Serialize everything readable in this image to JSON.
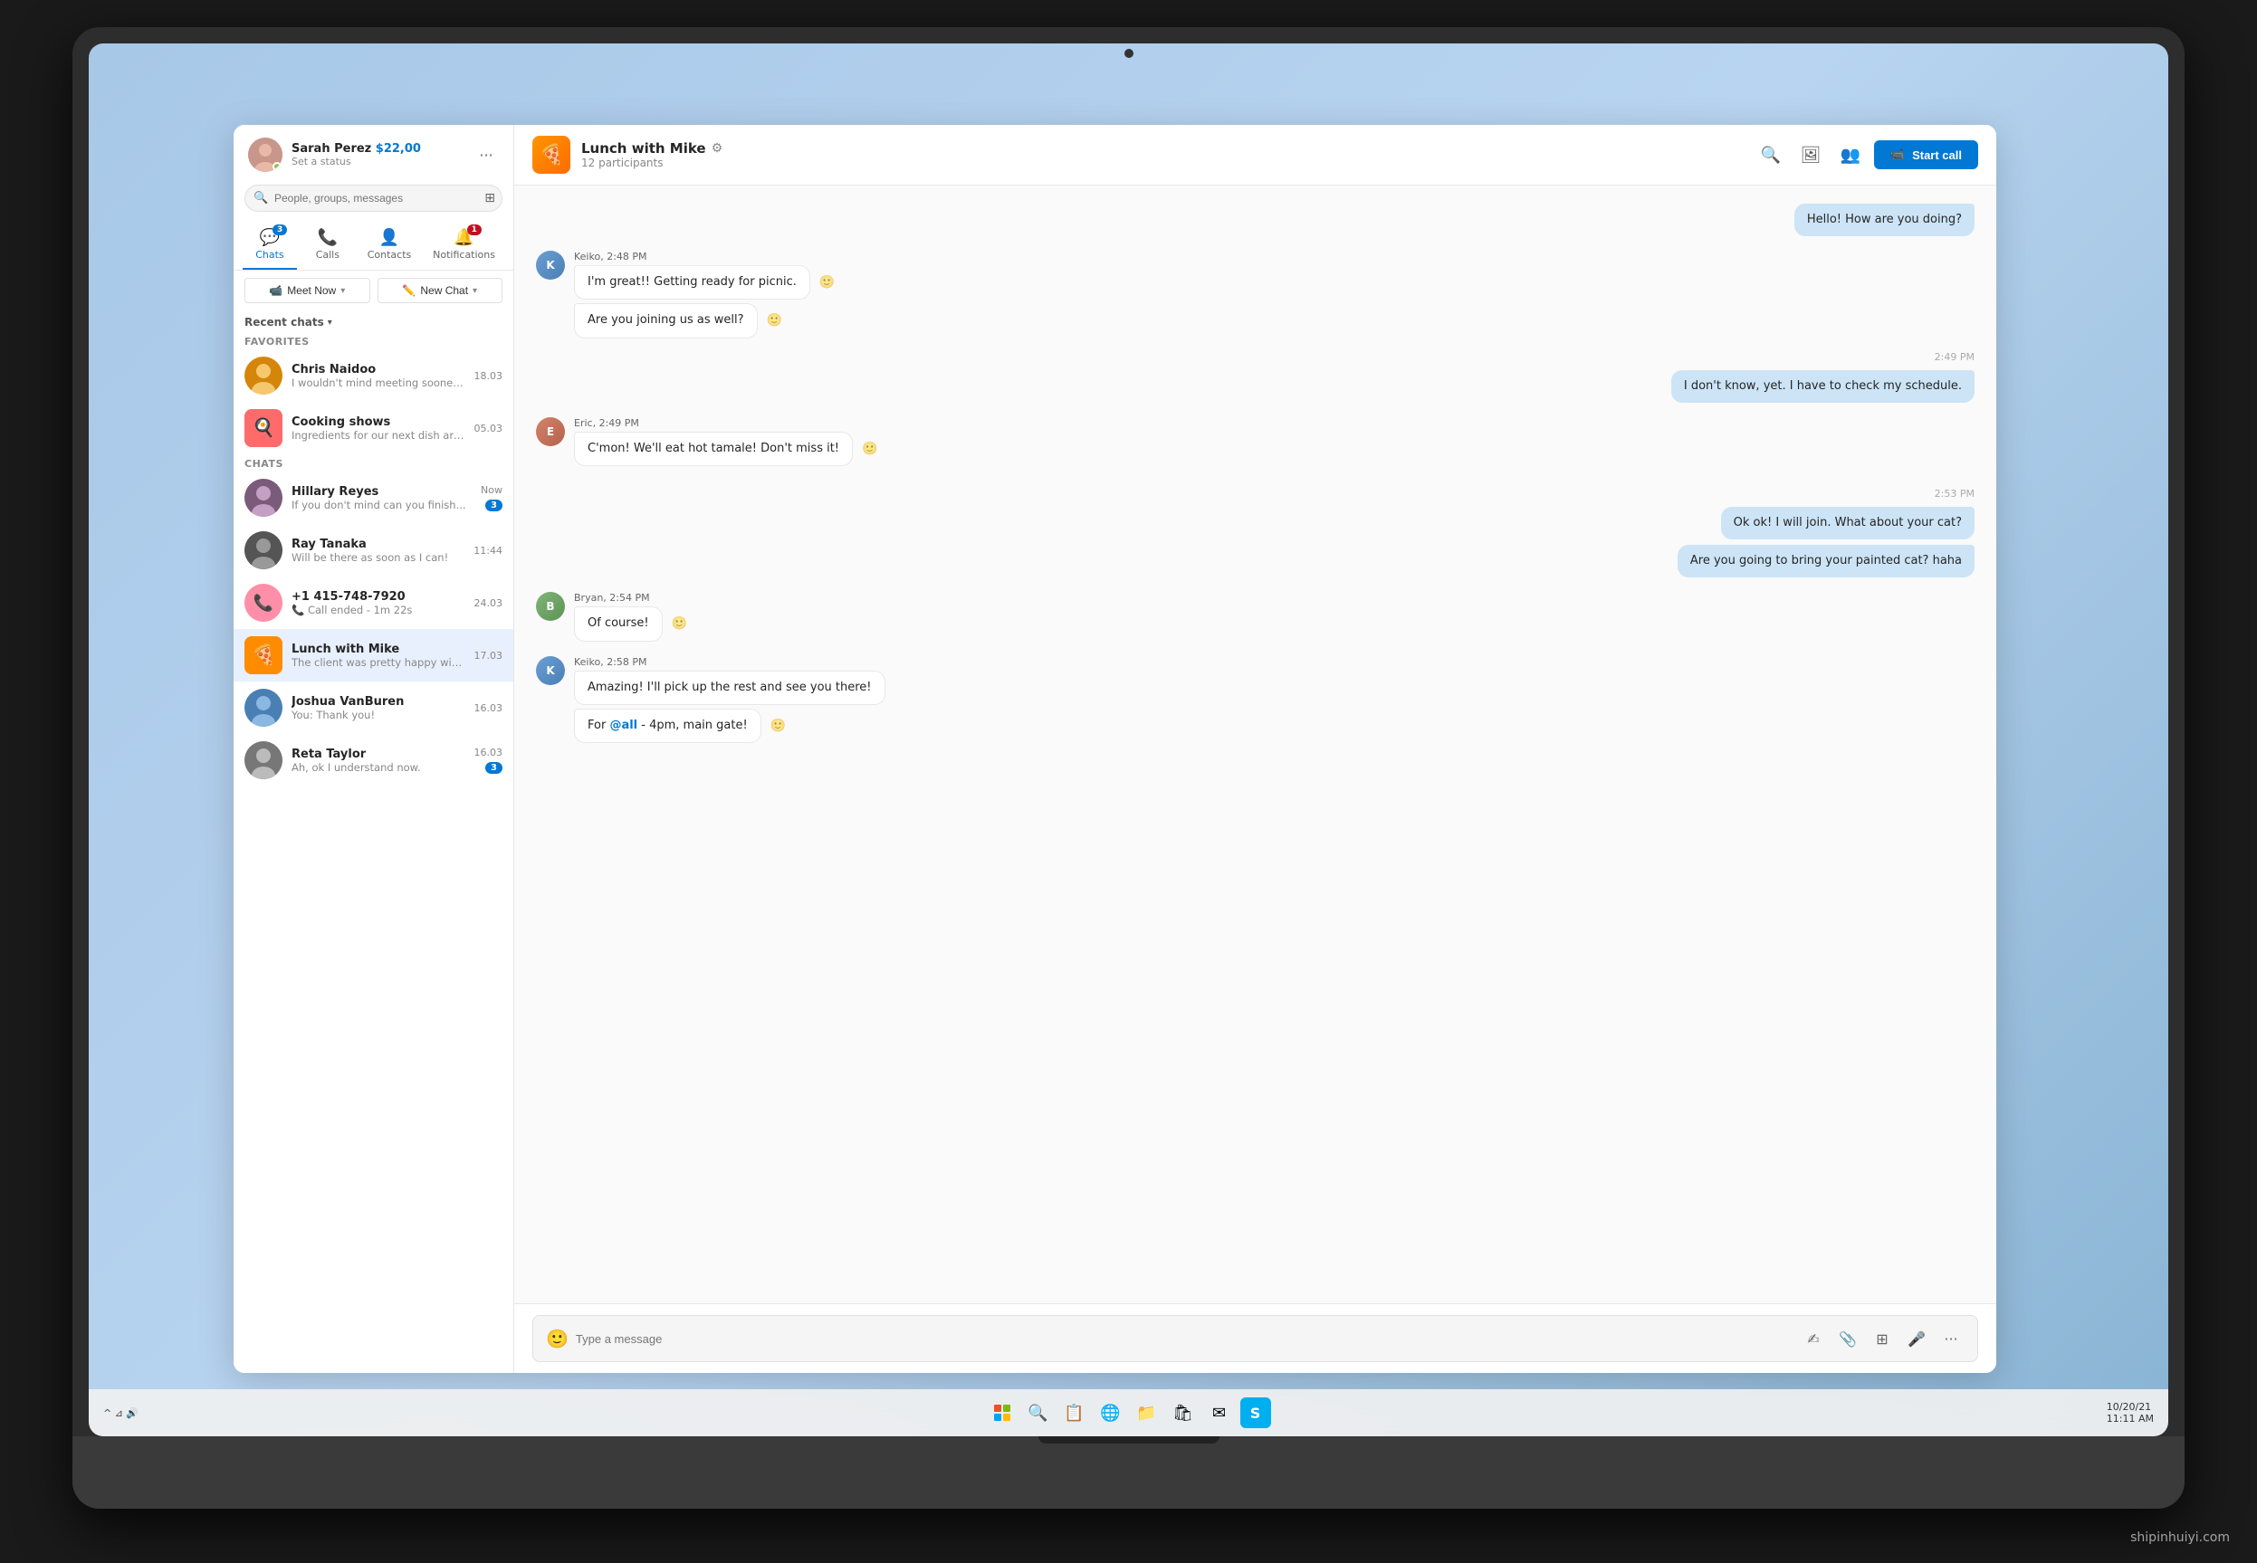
{
  "laptop": {
    "camera_label": "camera"
  },
  "taskbar": {
    "icons": [
      "⊞",
      "🔍",
      "📋",
      "⊟",
      "💬",
      "🗂",
      "🌐",
      "⛷"
    ],
    "time": "11:11 AM",
    "date": "10/20/21",
    "system_tray": "^ ⊿ 🔊"
  },
  "sidebar": {
    "user": {
      "name": "Sarah Perez",
      "credit": "$22,00",
      "status": "Set a status"
    },
    "search_placeholder": "People, groups, messages",
    "nav": {
      "chats": {
        "label": "Chats",
        "badge": "3"
      },
      "calls": {
        "label": "Calls",
        "badge": ""
      },
      "contacts": {
        "label": "Contacts",
        "badge": ""
      },
      "notifications": {
        "label": "Notifications",
        "badge": "1"
      }
    },
    "meet_now_label": "Meet Now",
    "new_chat_label": "New Chat",
    "recent_chats_label": "Recent chats",
    "favorites_label": "Favorites",
    "chats_label": "Chats",
    "contacts": [
      {
        "id": "chris",
        "name": "Chris Naidoo",
        "preview": "I wouldn't mind meeting sooner...",
        "time": "18.03",
        "badge": ""
      },
      {
        "id": "cooking",
        "name": "Cooking shows",
        "preview": "Ingredients for our next dish are...",
        "time": "05.03",
        "badge": ""
      },
      {
        "id": "hillary",
        "name": "Hillary Reyes",
        "preview": "If you don't mind can you finish...",
        "time": "Now",
        "badge": "3"
      },
      {
        "id": "ray",
        "name": "Ray Tanaka",
        "preview": "Will be there as soon as I can!",
        "time": "11:44",
        "badge": ""
      },
      {
        "id": "phone",
        "name": "+1 415-748-7920",
        "preview": "📞 Call ended - 1m 22s",
        "time": "24.03",
        "badge": ""
      },
      {
        "id": "lunch",
        "name": "Lunch with Mike",
        "preview": "The client was pretty happy with...",
        "time": "17.03",
        "badge": "",
        "active": true
      },
      {
        "id": "joshua",
        "name": "Joshua VanBuren",
        "preview": "You: Thank you!",
        "time": "16.03",
        "badge": ""
      },
      {
        "id": "reta",
        "name": "Reta Taylor",
        "preview": "Ah, ok I understand now.",
        "time": "16.03",
        "badge": "3"
      }
    ]
  },
  "chat": {
    "title": "Lunch with Mike",
    "participants": "12 participants",
    "start_call_label": "Start call",
    "messages": [
      {
        "id": "m1",
        "sender": "me",
        "text": "Hello! How are you doing?",
        "time": ""
      },
      {
        "id": "m2",
        "sender": "Keiko",
        "time_label": "Keiko, 2:48 PM",
        "bubbles": [
          "I'm great!! Getting ready for picnic.",
          "Are you joining us as well?"
        ]
      },
      {
        "id": "m3",
        "sender": "me",
        "time_divider": "2:49 PM",
        "text": "I don't know, yet. I have to check my schedule."
      },
      {
        "id": "m4",
        "sender": "Eric",
        "time_label": "Eric, 2:49 PM",
        "bubbles": [
          "C'mon! We'll eat hot tamale! Don't miss it!"
        ]
      },
      {
        "id": "m5",
        "sender": "me",
        "time_divider": "2:53 PM",
        "bubbles": [
          "Ok ok! I will join. What about your cat?",
          "Are you going to bring your painted cat? haha"
        ]
      },
      {
        "id": "m6",
        "sender": "Bryan",
        "time_label": "Bryan, 2:54 PM",
        "bubbles": [
          "Of course!"
        ]
      },
      {
        "id": "m7",
        "sender": "Keiko",
        "time_label": "Keiko, 2:58 PM",
        "bubbles": [
          "Amazing! I'll pick up the rest and see you there!",
          "For @all - 4pm, main gate!"
        ]
      }
    ],
    "input_placeholder": "Type a message"
  },
  "watermark": "shipinhuiyi.com"
}
